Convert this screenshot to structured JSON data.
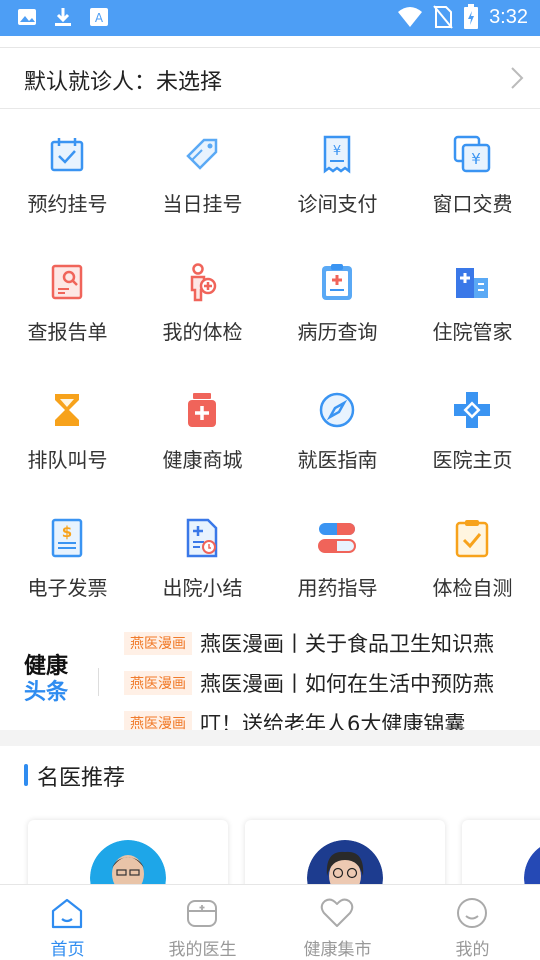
{
  "status_bar": {
    "time": "3:32",
    "icons": [
      "image-icon",
      "download-icon",
      "font-a-icon",
      "wifi-icon",
      "no-sim-icon",
      "battery-icon"
    ]
  },
  "patient": {
    "label": "默认就诊人：未选择"
  },
  "grid": [
    {
      "label": "预约挂号",
      "icon": "calendar-check-icon"
    },
    {
      "label": "当日挂号",
      "icon": "tag-icon"
    },
    {
      "label": "诊间支付",
      "icon": "receipt-yuan-icon"
    },
    {
      "label": "窗口交费",
      "icon": "window-yuan-icon"
    },
    {
      "label": "查报告单",
      "icon": "report-search-icon"
    },
    {
      "label": "我的体检",
      "icon": "body-check-icon"
    },
    {
      "label": "病历查询",
      "icon": "clipboard-cross-icon"
    },
    {
      "label": "住院管家",
      "icon": "hospital-building-icon"
    },
    {
      "label": "排队叫号",
      "icon": "hourglass-icon"
    },
    {
      "label": "健康商城",
      "icon": "medicine-bottle-icon"
    },
    {
      "label": "就医指南",
      "icon": "compass-icon"
    },
    {
      "label": "医院主页",
      "icon": "hospital-cross-icon"
    },
    {
      "label": "电子发票",
      "icon": "invoice-dollar-icon"
    },
    {
      "label": "出院小结",
      "icon": "discharge-doc-icon"
    },
    {
      "label": "用药指导",
      "icon": "capsule-icon"
    },
    {
      "label": "体检自测",
      "icon": "clipboard-check-icon"
    }
  ],
  "news": {
    "logo_line1": "健康",
    "logo_line2": "头条",
    "items": [
      {
        "tag": "燕医漫画",
        "title": "燕医漫画丨关于食品卫生知识燕"
      },
      {
        "tag": "燕医漫画",
        "title": "燕医漫画丨如何在生活中预防燕"
      },
      {
        "tag": "燕医漫画",
        "title": "叮！送给老年人6大健康锦囊"
      }
    ]
  },
  "section": {
    "title": "名医推荐"
  },
  "tabs": [
    {
      "label": "首页",
      "icon": "home-icon",
      "active": true
    },
    {
      "label": "我的医生",
      "icon": "doctor-bag-icon",
      "active": false
    },
    {
      "label": "健康集市",
      "icon": "heart-icon",
      "active": false
    },
    {
      "label": "我的",
      "icon": "smile-face-icon",
      "active": false
    }
  ],
  "colors": {
    "accent": "#2f8cf0",
    "status_bar": "#4d9ef5",
    "tag_bg": "#fff0e6",
    "tag_text": "#f07a2a",
    "icon_red": "#f0645a",
    "icon_orange": "#f7a21b"
  }
}
